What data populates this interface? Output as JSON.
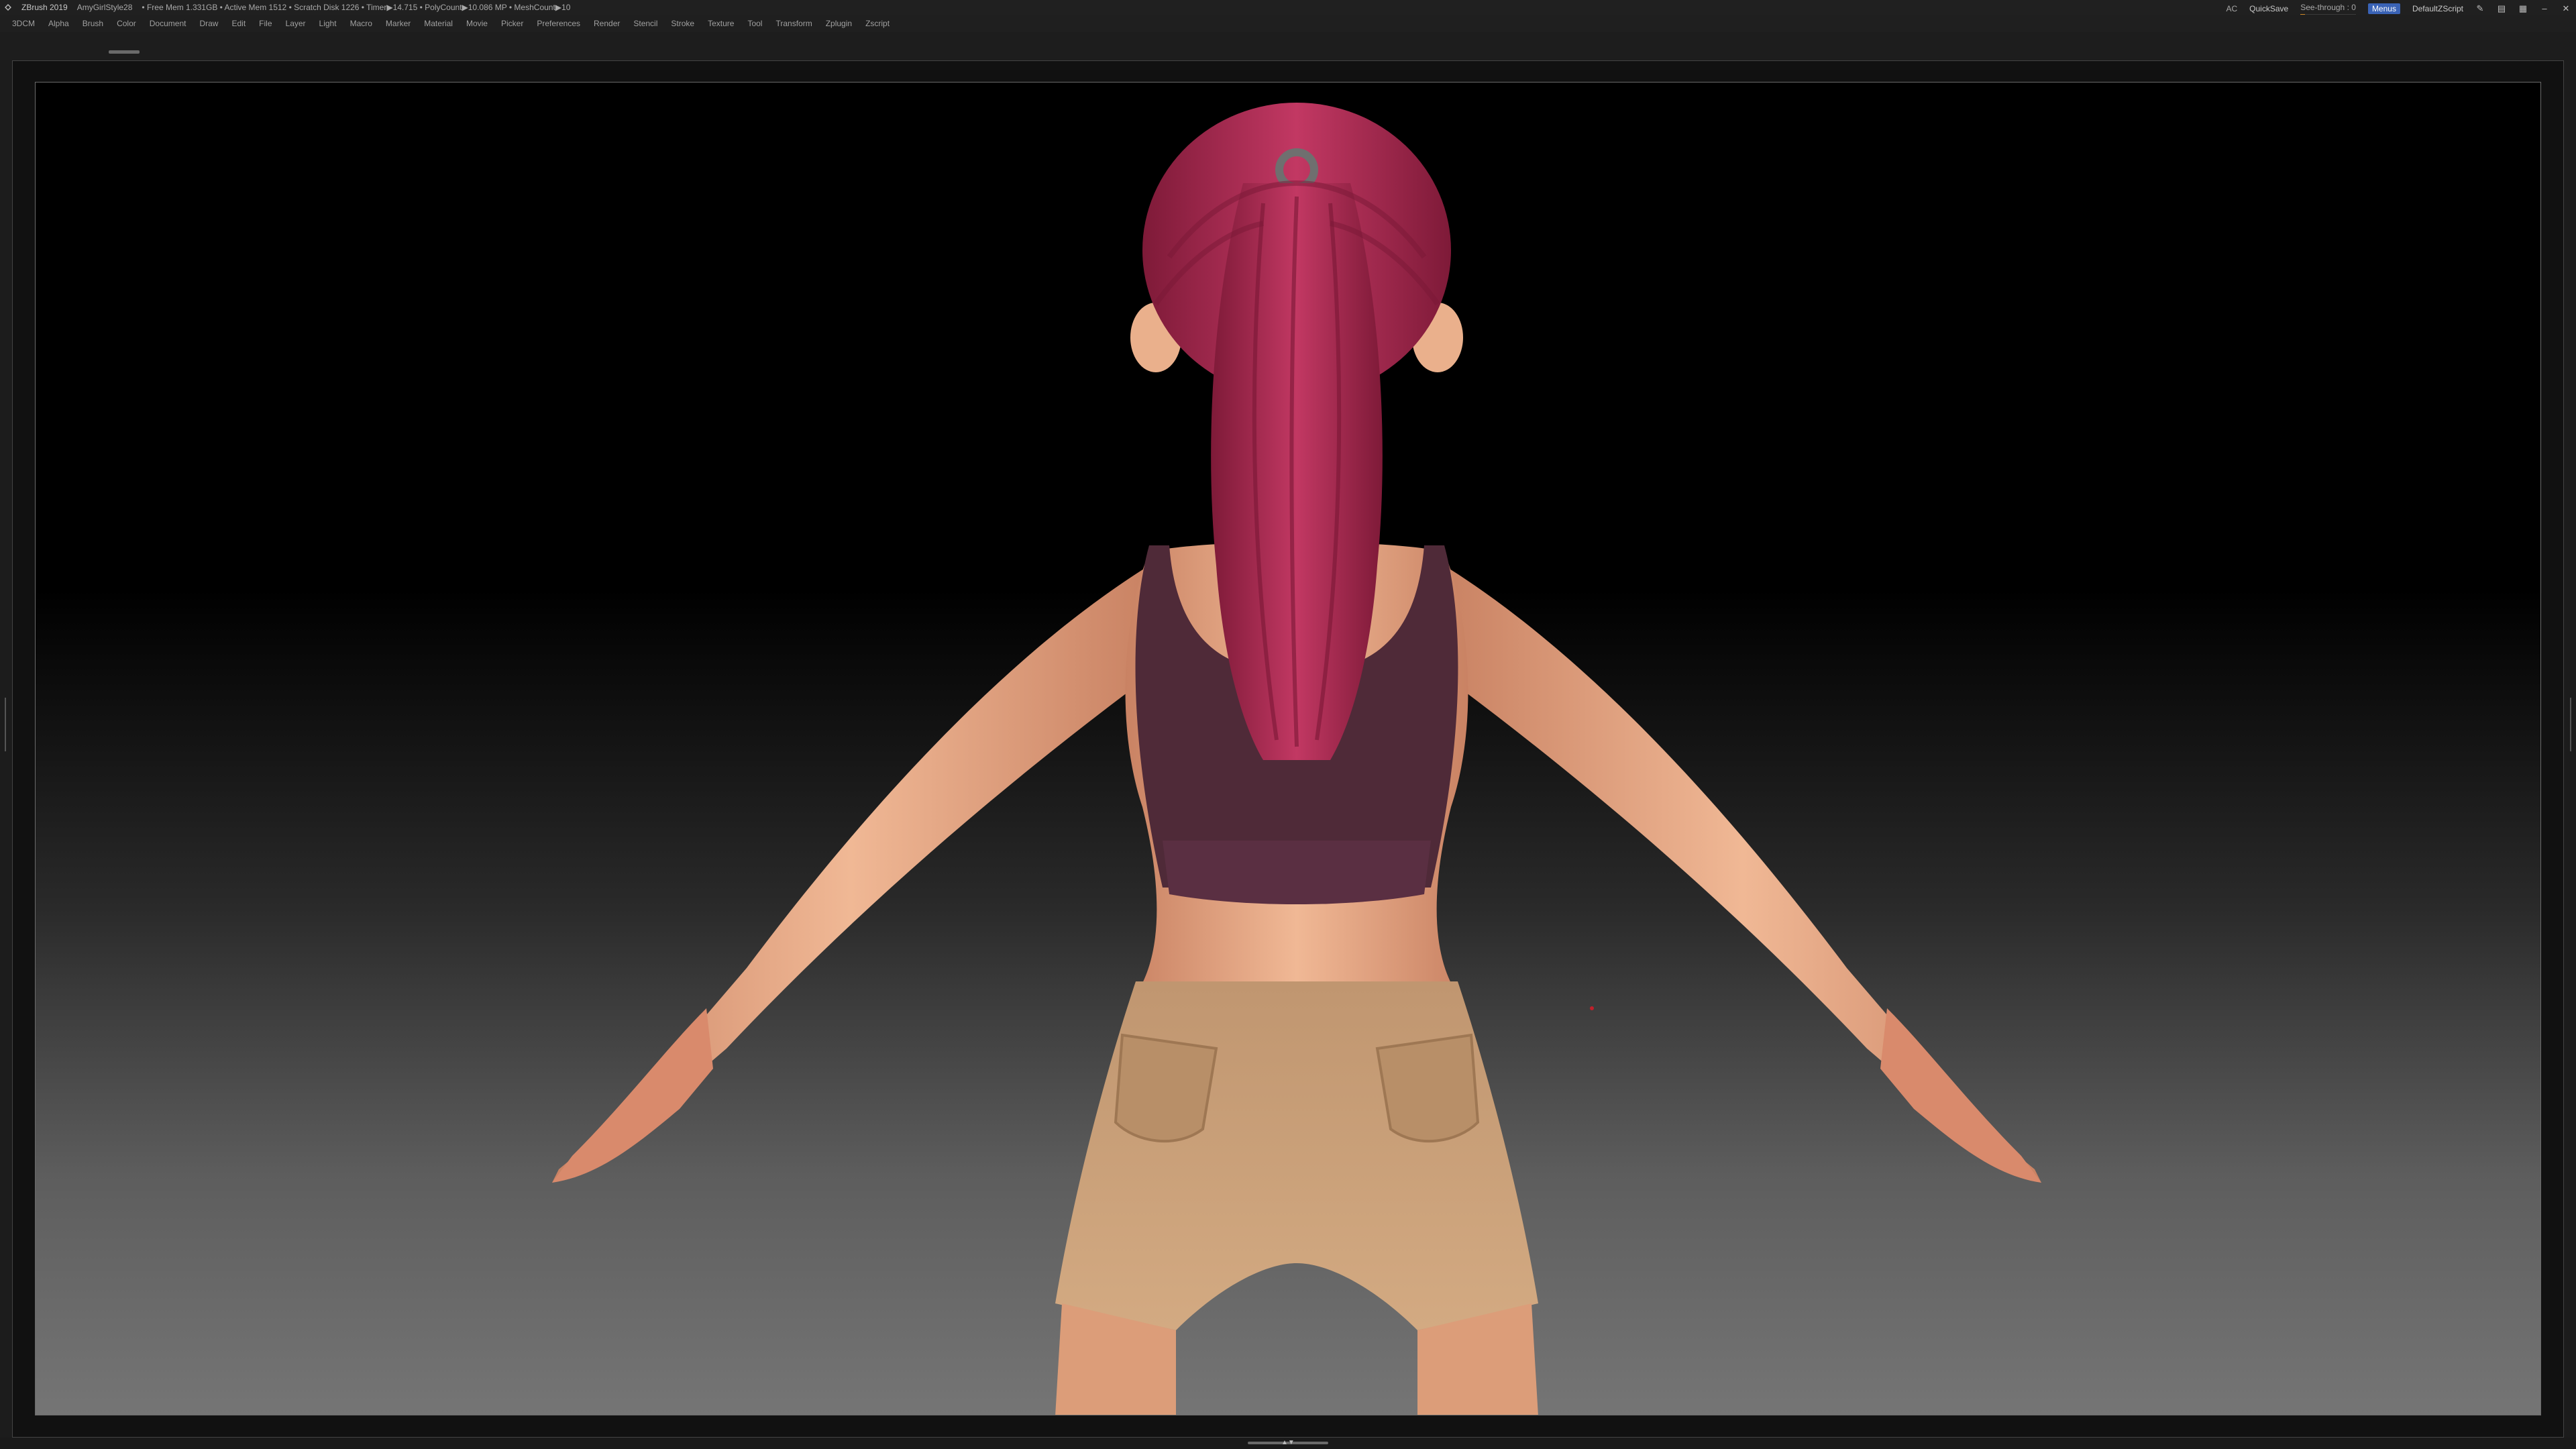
{
  "titlebar": {
    "app": "ZBrush 2019",
    "project": "AmyGirlStyle28",
    "stats": "• Free Mem 1.331GB • Active Mem 1512 • Scratch Disk 1226 • Timer▶14.715 • PolyCount▶10.086 MP • MeshCount▶10",
    "ac": "AC",
    "quicksave": "QuickSave",
    "seethrough_label": "See-through",
    "seethrough_value": "0",
    "menus": "Menus",
    "script": "DefaultZScript",
    "icons": [
      "brush-icon",
      "palette-icon",
      "layout-icon",
      "minimize-icon",
      "close-icon"
    ]
  },
  "menubar": {
    "items": [
      "3DCM",
      "Alpha",
      "Brush",
      "Color",
      "Document",
      "Draw",
      "Edit",
      "File",
      "Layer",
      "Light",
      "Macro",
      "Marker",
      "Material",
      "Movie",
      "Picker",
      "Preferences",
      "Render",
      "Stencil",
      "Stroke",
      "Texture",
      "Tool",
      "Transform",
      "Zplugin",
      "Zscript"
    ]
  },
  "colors": {
    "skin": "#e6a884",
    "hair": "#a6284d",
    "top": "#4f2a38",
    "shorts": "#c9a078",
    "accent": "#3a63b6"
  }
}
